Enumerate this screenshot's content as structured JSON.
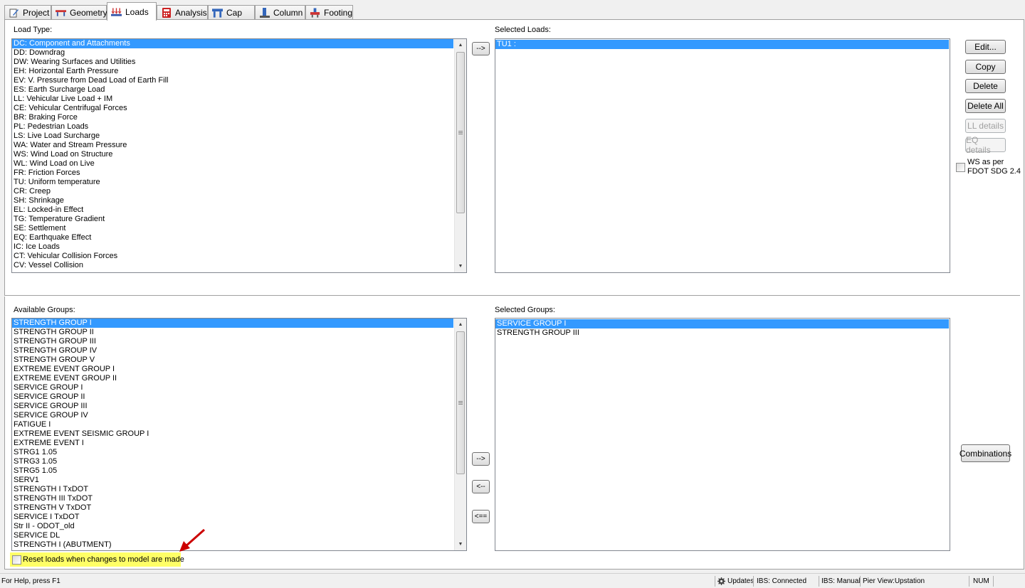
{
  "tabs": [
    {
      "label": "Project",
      "icon": "project-icon"
    },
    {
      "label": "Geometry",
      "icon": "geometry-icon"
    },
    {
      "label": "Loads",
      "icon": "loads-icon",
      "active": true
    },
    {
      "label": "Analysis",
      "icon": "analysis-icon"
    },
    {
      "label": "Cap",
      "icon": "cap-icon"
    },
    {
      "label": "Column",
      "icon": "column-icon"
    },
    {
      "label": "Footing",
      "icon": "footing-icon"
    }
  ],
  "load_type": {
    "label": "Load Type:",
    "selected_index": 0,
    "items": [
      "DC: Component and Attachments",
      "DD: Downdrag",
      "DW: Wearing Surfaces and Utilities",
      "EH: Horizontal Earth Pressure",
      "EV: V. Pressure from Dead Load of Earth Fill",
      "ES: Earth Surcharge Load",
      "LL: Vehicular Live Load + IM",
      "CE: Vehicular Centrifugal Forces",
      "BR: Braking Force",
      "PL: Pedestrian Loads",
      "LS: Live Load Surcharge",
      "WA: Water and Stream Pressure",
      "WS: Wind Load on Structure",
      "WL: Wind Load on Live",
      "FR: Friction Forces",
      "TU: Uniform temperature",
      "CR: Creep",
      "SH: Shrinkage",
      "EL: Locked-in Effect",
      "TG: Temperature Gradient",
      "SE: Settlement",
      "EQ: Earthquake Effect",
      "IC: Ice Loads",
      "CT: Vehicular Collision Forces",
      "CV: Vessel Collision"
    ]
  },
  "add_load_button": "-->",
  "selected_loads": {
    "label": "Selected Loads:",
    "items": [
      "TU1        :"
    ],
    "selected_index": 0
  },
  "load_buttons": {
    "edit": "Edit...",
    "copy": "Copy",
    "delete": "Delete",
    "delete_all": "Delete All",
    "ll_details": "LL details",
    "eq_details": "EQ details"
  },
  "ws_checkbox": {
    "line1": "WS as per",
    "line2": "FDOT SDG 2.4",
    "checked": false
  },
  "available_groups": {
    "label": "Available Groups:",
    "selected_index": 0,
    "items": [
      "STRENGTH GROUP I",
      "STRENGTH GROUP II",
      "STRENGTH GROUP III",
      "STRENGTH GROUP IV",
      "STRENGTH GROUP V",
      "EXTREME EVENT GROUP I",
      "EXTREME EVENT GROUP II",
      "SERVICE GROUP I",
      "SERVICE GROUP II",
      "SERVICE GROUP III",
      "SERVICE GROUP IV",
      "FATIGUE I",
      "EXTREME EVENT SEISMIC GROUP I",
      "EXTREME EVENT I",
      "STRG1 1.05",
      "STRG3 1.05",
      "STRG5 1.05",
      "SERV1",
      "STRENGTH I TxDOT",
      "STRENGTH III TxDOT",
      "STRENGTH V TxDOT",
      "SERVICE I TxDOT",
      "Str II - ODOT_old",
      "SERVICE DL",
      "STRENGTH I (ABUTMENT)"
    ]
  },
  "group_buttons": {
    "add": "-->",
    "remove": "<--",
    "remove_all": "<=="
  },
  "selected_groups": {
    "label": "Selected Groups:",
    "selected_index": 0,
    "items": [
      "SERVICE GROUP I",
      "STRENGTH GROUP III"
    ]
  },
  "combinations_button": "Combinations",
  "reset_checkbox": {
    "label": "Reset loads when changes to model are made",
    "checked": false
  },
  "status": {
    "help": "For Help, press F1",
    "updates": "Updates",
    "ibs_connected": "IBS: Connected",
    "ibs_manual": "IBS: Manual",
    "pier_view": "Pier View:Upstation",
    "num": "NUM"
  },
  "colors": {
    "selection": "#3399ff",
    "highlight": "#ffff66",
    "arrow": "#cc0000"
  }
}
